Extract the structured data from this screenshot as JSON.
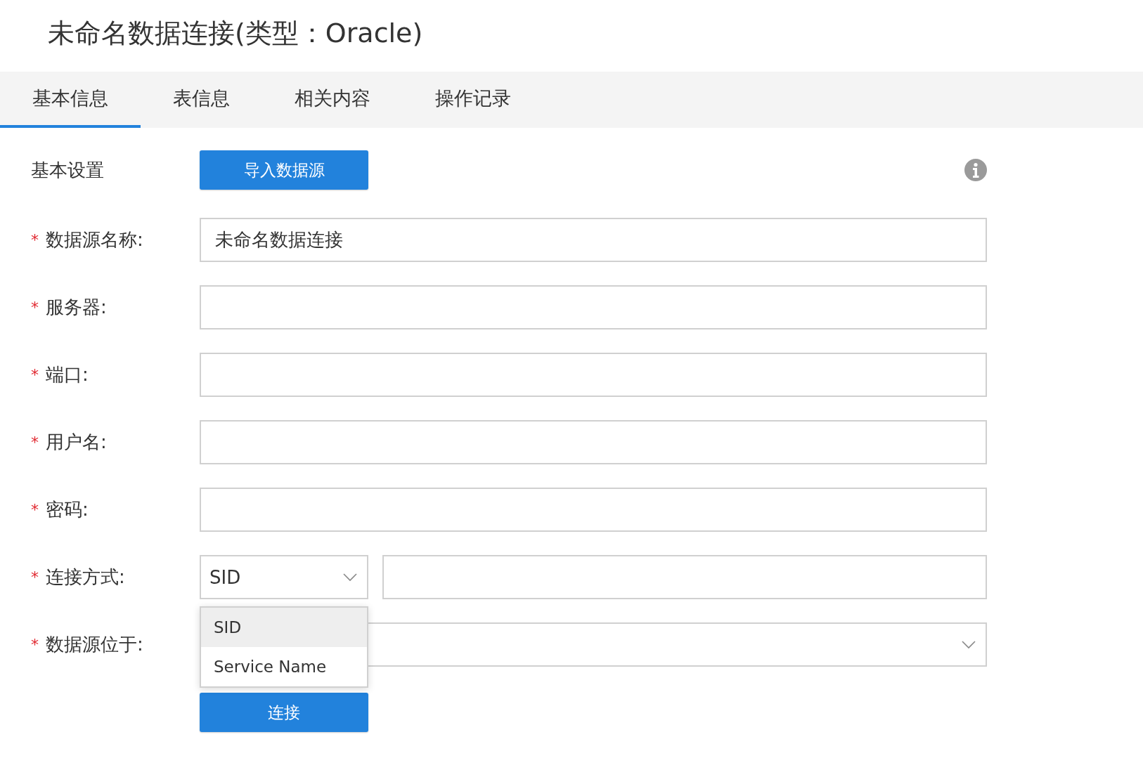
{
  "title": "未命名数据连接(类型：Oracle)",
  "tabs": [
    {
      "label": "基本信息",
      "selected": true
    },
    {
      "label": "表信息",
      "selected": false
    },
    {
      "label": "相关内容",
      "selected": false
    },
    {
      "label": "操作记录",
      "selected": false
    }
  ],
  "section": {
    "label": "基本设置",
    "button": "导入数据源"
  },
  "fields": [
    {
      "kind": "text",
      "required_mark": "*",
      "label": "数据源名称:",
      "value": "未命名数据连接"
    },
    {
      "kind": "text",
      "required_mark": "*",
      "label": "服务器:"
    },
    {
      "kind": "text",
      "required_mark": "*",
      "label": "端口:"
    },
    {
      "kind": "text",
      "required_mark": "*",
      "label": "用户名:"
    },
    {
      "kind": "text",
      "required_mark": "*",
      "label": "密码:"
    },
    {
      "kind": "select-with-input",
      "required_mark": "*",
      "label": "连接方式:",
      "value": "SID",
      "dropdown": {
        "expanded": true,
        "options": [
          {
            "label": "SID",
            "selected": true
          },
          {
            "label": "Service Name",
            "selected": false
          }
        ]
      }
    },
    {
      "kind": "select",
      "required_mark": "*",
      "label": "数据源位于:"
    }
  ],
  "connect_button": "连接"
}
